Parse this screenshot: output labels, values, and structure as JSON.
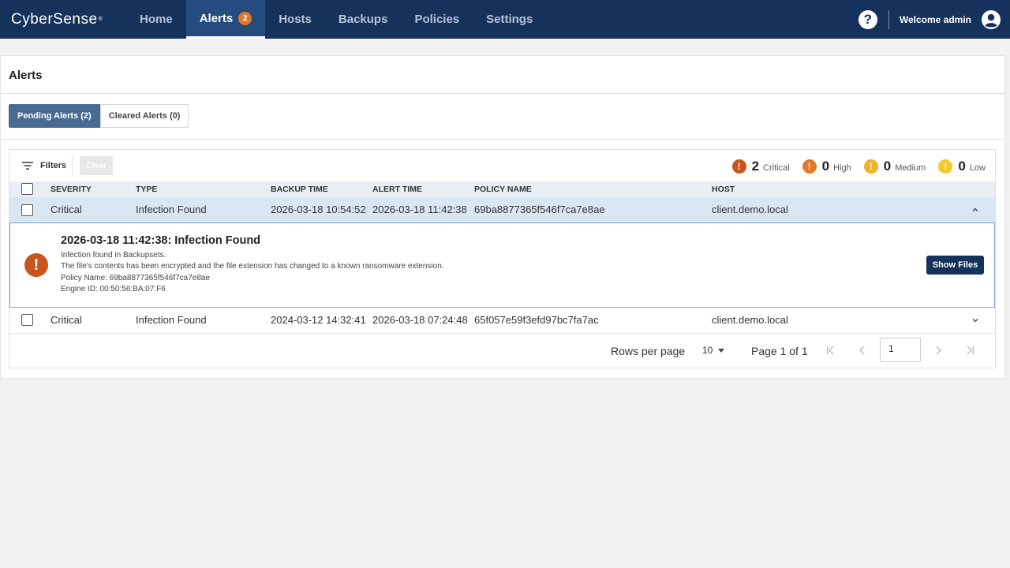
{
  "app": {
    "logo": "CyberSense",
    "logo_mark": "®"
  },
  "nav": {
    "items": [
      {
        "label": "Home"
      },
      {
        "label": "Alerts",
        "badge": "2"
      },
      {
        "label": "Hosts"
      },
      {
        "label": "Backups"
      },
      {
        "label": "Policies"
      },
      {
        "label": "Settings"
      }
    ],
    "help": "?",
    "welcome": "Welcome admin"
  },
  "page": {
    "title": "Alerts",
    "tabs": [
      {
        "label": "Pending Alerts (2)"
      },
      {
        "label": "Cleared Alerts (0)"
      }
    ]
  },
  "toolbar": {
    "filters_label": "Filters",
    "clear_label": "Clear",
    "counts": [
      {
        "count": "2",
        "label": "Critical",
        "color": "#c9541c"
      },
      {
        "count": "0",
        "label": "High",
        "color": "#e07a2a"
      },
      {
        "count": "0",
        "label": "Medium",
        "color": "#f1b12b"
      },
      {
        "count": "0",
        "label": "Low",
        "color": "#f6c928"
      }
    ]
  },
  "table": {
    "columns": [
      "SEVERITY",
      "TYPE",
      "BACKUP TIME",
      "ALERT TIME",
      "POLICY NAME",
      "HOST"
    ],
    "rows": [
      {
        "severity": "Critical",
        "type": "Infection Found",
        "backup_time": "2026-03-18 10:54:52",
        "alert_time": "2026-03-18 11:42:38",
        "policy": "69ba8877365f546f7ca7e8ae",
        "host": "client.demo.local"
      },
      {
        "severity": "Critical",
        "type": "Infection Found",
        "backup_time": "2024-03-12 14:32:41",
        "alert_time": "2026-03-18 07:24:48",
        "policy": "65f057e59f3efd97bc7fa7ac",
        "host": "client.demo.local"
      }
    ],
    "detail": {
      "title": "2026-03-18 11:42:38: Infection Found",
      "lines": [
        "Infection found in Backupsets.",
        "The file's contents has been encrypted and the file extension has changed to a known ransomware extension.",
        "Policy Name: 69ba8877365f546f7ca7e8ae",
        "Engine ID: 00:50:56:BA:07:F6"
      ],
      "icon": "!",
      "button": "Show Files"
    }
  },
  "pager": {
    "rows_per_page_label": "Rows per page",
    "rows_per_page": "10",
    "page_info": "Page 1 of 1",
    "page_input": "1"
  },
  "colors": {
    "nav_bg": "#15325c",
    "accent": "#4a6b91",
    "critical": "#c9541c"
  }
}
